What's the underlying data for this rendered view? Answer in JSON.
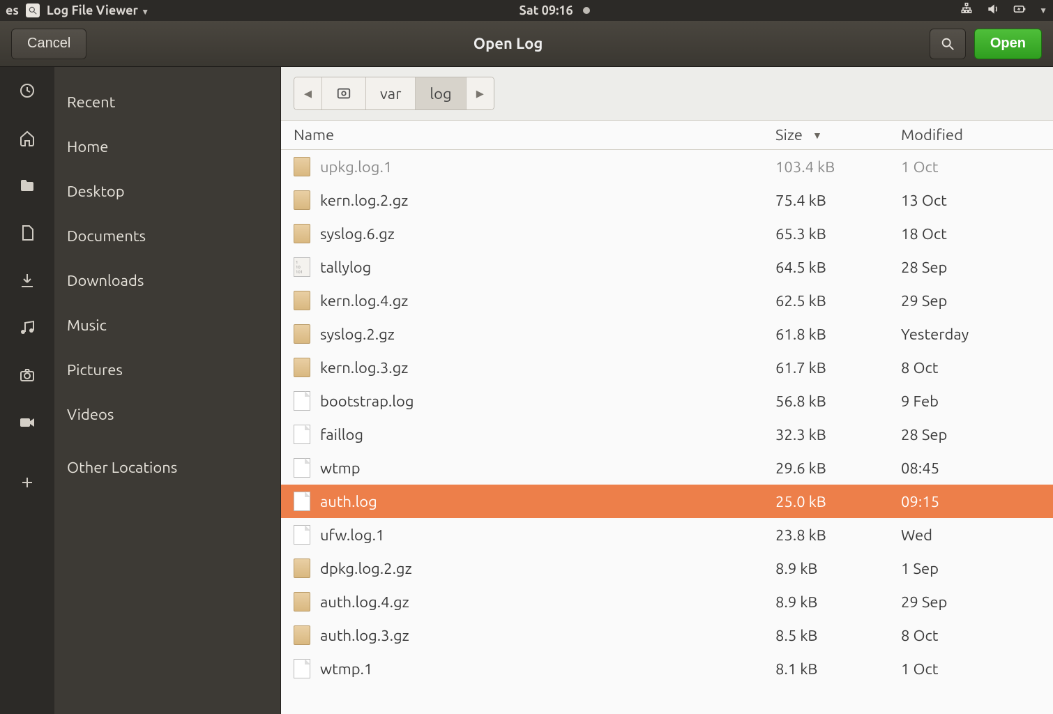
{
  "topbar": {
    "left_fragment": "es",
    "app_name": "Log File Viewer",
    "clock": "Sat 09:16"
  },
  "header": {
    "cancel": "Cancel",
    "title": "Open Log",
    "open": "Open"
  },
  "sidebar": {
    "items": [
      {
        "icon": "clock",
        "label": "Recent"
      },
      {
        "icon": "home",
        "label": "Home"
      },
      {
        "icon": "folder",
        "label": "Desktop"
      },
      {
        "icon": "doc",
        "label": "Documents"
      },
      {
        "icon": "download",
        "label": "Downloads"
      },
      {
        "icon": "music",
        "label": "Music"
      },
      {
        "icon": "camera",
        "label": "Pictures"
      },
      {
        "icon": "video",
        "label": "Videos"
      },
      {
        "icon": "plus",
        "label": "Other Locations"
      }
    ]
  },
  "pathbar": {
    "segments": [
      "var",
      "log"
    ],
    "active_index": 1
  },
  "columns": {
    "name": "Name",
    "size": "Size",
    "modified": "Modified"
  },
  "files": [
    {
      "name": "upkg.log.1",
      "size": "103.4 kB",
      "modified": "1 Oct",
      "icon": "pkg",
      "cut": true
    },
    {
      "name": "kern.log.2.gz",
      "size": "75.4 kB",
      "modified": "13 Oct",
      "icon": "pkg"
    },
    {
      "name": "syslog.6.gz",
      "size": "65.3 kB",
      "modified": "18 Oct",
      "icon": "pkg"
    },
    {
      "name": "tallylog",
      "size": "64.5 kB",
      "modified": "28 Sep",
      "icon": "bin"
    },
    {
      "name": "kern.log.4.gz",
      "size": "62.5 kB",
      "modified": "29 Sep",
      "icon": "pkg"
    },
    {
      "name": "syslog.2.gz",
      "size": "61.8 kB",
      "modified": "Yesterday",
      "icon": "pkg"
    },
    {
      "name": "kern.log.3.gz",
      "size": "61.7 kB",
      "modified": "8 Oct",
      "icon": "pkg"
    },
    {
      "name": "bootstrap.log",
      "size": "56.8 kB",
      "modified": "9 Feb",
      "icon": "doc"
    },
    {
      "name": "faillog",
      "size": "32.3 kB",
      "modified": "28 Sep",
      "icon": "doc"
    },
    {
      "name": "wtmp",
      "size": "29.6 kB",
      "modified": "08:45",
      "icon": "doc"
    },
    {
      "name": "auth.log",
      "size": "25.0 kB",
      "modified": "09:15",
      "icon": "doc",
      "selected": true
    },
    {
      "name": "ufw.log.1",
      "size": "23.8 kB",
      "modified": "Wed",
      "icon": "doc"
    },
    {
      "name": "dpkg.log.2.gz",
      "size": "8.9 kB",
      "modified": "1 Sep",
      "icon": "pkg"
    },
    {
      "name": "auth.log.4.gz",
      "size": "8.9 kB",
      "modified": "29 Sep",
      "icon": "pkg"
    },
    {
      "name": "auth.log.3.gz",
      "size": "8.5 kB",
      "modified": "8 Oct",
      "icon": "pkg"
    },
    {
      "name": "wtmp.1",
      "size": "8.1 kB",
      "modified": "1 Oct",
      "icon": "doc"
    }
  ]
}
